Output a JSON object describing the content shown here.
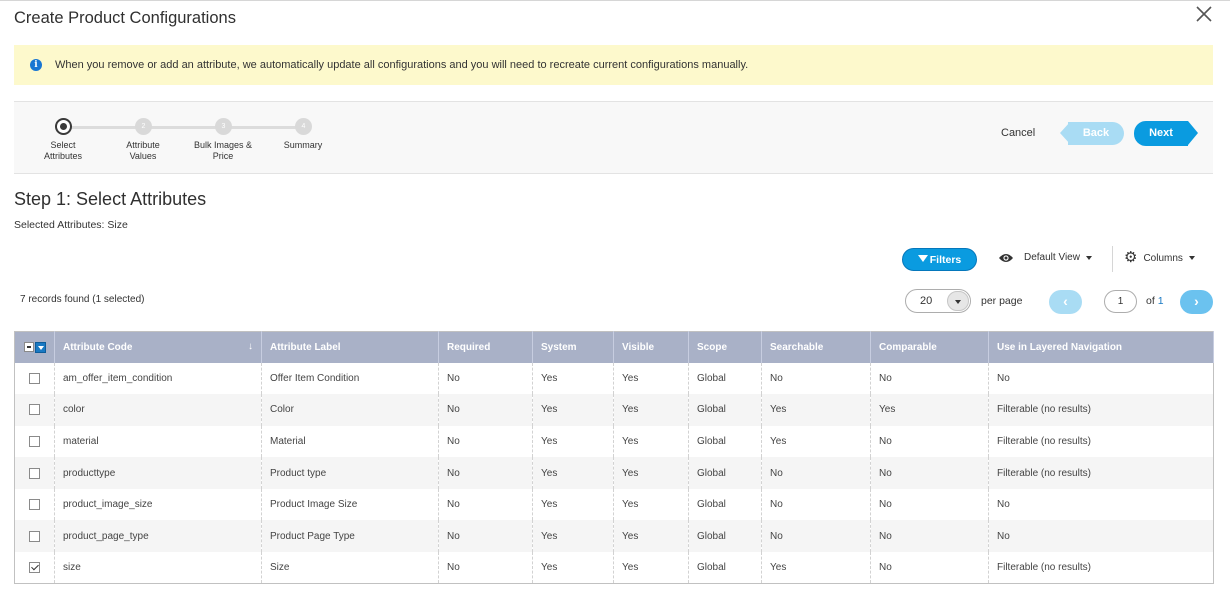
{
  "modal": {
    "title": "Create Product Configurations",
    "close_icon": "close-icon"
  },
  "notice": {
    "icon": "info-icon",
    "message": "When you remove or add an attribute, we automatically update all configurations and you will need to recreate current configurations manually."
  },
  "wizard": {
    "steps": [
      {
        "number": "1",
        "label_line1": "Select",
        "label_line2": "Attributes",
        "active": true
      },
      {
        "number": "2",
        "label_line1": "Attribute",
        "label_line2": "Values",
        "active": false
      },
      {
        "number": "3",
        "label_line1": "Bulk Images &",
        "label_line2": "Price",
        "active": false
      },
      {
        "number": "4",
        "label_line1": "Summary",
        "label_line2": "",
        "active": false
      }
    ],
    "cancel_label": "Cancel",
    "back_label": "Back",
    "next_label": "Next",
    "accent_color": "#0a9be0"
  },
  "step": {
    "heading": "Step 1: Select Attributes",
    "selected_attributes": "Selected Attributes: Size"
  },
  "toolbar": {
    "filters_label": "Filters",
    "view_label": "Default View",
    "columns_label": "Columns"
  },
  "pager": {
    "records_text": "7 records found (1 selected)",
    "per_page_value": "20",
    "per_page_label": "per page",
    "current_page": "1",
    "of_label": "of",
    "total_pages": "1"
  },
  "grid": {
    "columns": [
      "Attribute Code",
      "Attribute Label",
      "Required",
      "System",
      "Visible",
      "Scope",
      "Searchable",
      "Comparable",
      "Use in Layered Navigation"
    ],
    "sort_indicator": "↓",
    "rows": [
      {
        "checked": false,
        "cells": [
          "am_offer_item_condition",
          "Offer Item Condition",
          "No",
          "Yes",
          "Yes",
          "Global",
          "No",
          "No",
          "No"
        ]
      },
      {
        "checked": false,
        "cells": [
          "color",
          "Color",
          "No",
          "Yes",
          "Yes",
          "Global",
          "Yes",
          "Yes",
          "Filterable (no results)"
        ]
      },
      {
        "checked": false,
        "cells": [
          "material",
          "Material",
          "No",
          "Yes",
          "Yes",
          "Global",
          "Yes",
          "No",
          "Filterable (no results)"
        ]
      },
      {
        "checked": false,
        "cells": [
          "producttype",
          "Product type",
          "No",
          "Yes",
          "Yes",
          "Global",
          "No",
          "No",
          "Filterable (no results)"
        ]
      },
      {
        "checked": false,
        "cells": [
          "product_image_size",
          "Product Image Size",
          "No",
          "Yes",
          "Yes",
          "Global",
          "No",
          "No",
          "No"
        ]
      },
      {
        "checked": false,
        "cells": [
          "product_page_type",
          "Product Page Type",
          "No",
          "Yes",
          "Yes",
          "Global",
          "No",
          "No",
          "No"
        ]
      },
      {
        "checked": true,
        "cells": [
          "size",
          "Size",
          "No",
          "Yes",
          "Yes",
          "Global",
          "Yes",
          "No",
          "Filterable (no results)"
        ]
      }
    ]
  }
}
